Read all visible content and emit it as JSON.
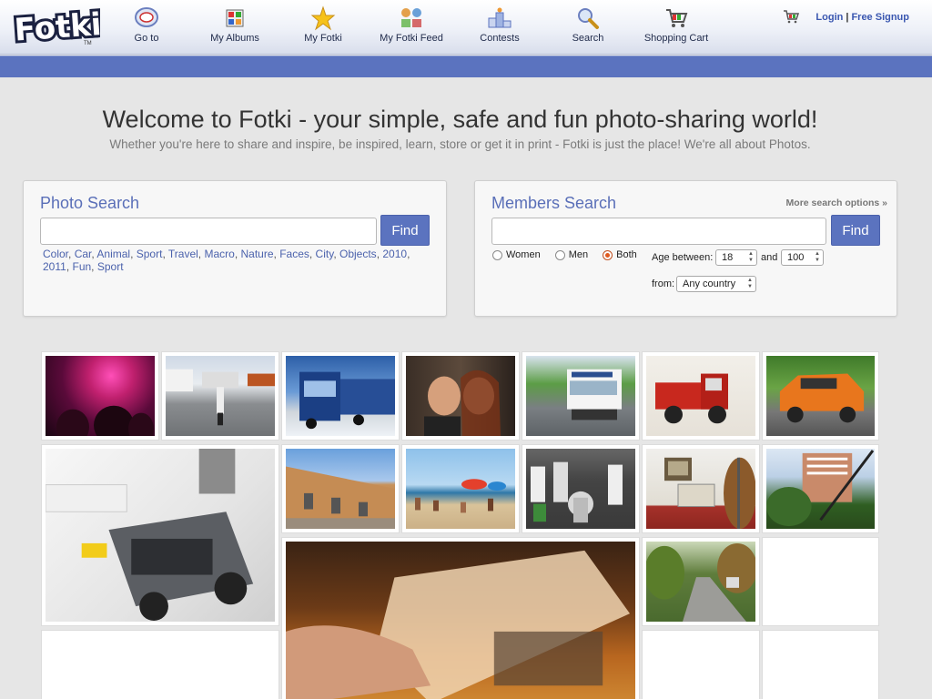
{
  "header": {
    "logo_text": "Fotki",
    "nav": [
      {
        "label": "Go to",
        "icon": "compass-icon"
      },
      {
        "label": "My Albums",
        "icon": "albums-icon"
      },
      {
        "label": "My Fotki",
        "icon": "star-icon"
      },
      {
        "label": "My Fotki Feed",
        "icon": "feed-icon"
      },
      {
        "label": "Contests",
        "icon": "podium-icon"
      },
      {
        "label": "Search",
        "icon": "magnifier-icon"
      },
      {
        "label": "Shopping Cart",
        "icon": "cart-icon"
      }
    ],
    "login": "Login",
    "separator": "|",
    "signup": "Free Signup"
  },
  "welcome": {
    "title": "Welcome to Fotki - your simple, safe and fun photo-sharing world!",
    "tagline": "Whether you're here to share and inspire, be inspired, learn, store or get it in print - Fotki is just the place! We're all about Photos."
  },
  "photo_search": {
    "title": "Photo Search",
    "input_value": "",
    "find_label": "Find",
    "tags": [
      "Color",
      "Car",
      "Animal",
      "Sport",
      "Travel",
      "Macro",
      "Nature",
      "Faces",
      "City",
      "Objects",
      "2010",
      "2011",
      "Fun",
      "Sport"
    ]
  },
  "members_search": {
    "title": "Members Search",
    "more_options": "More search options »",
    "input_value": "",
    "find_label": "Find",
    "gender": {
      "women": "Women",
      "men": "Men",
      "both": "Both",
      "selected": "Both"
    },
    "age_label": "Age between:",
    "age_min": "18",
    "and_label": "and",
    "age_max": "100",
    "from_label": "from:",
    "country": "Any country"
  },
  "colors": {
    "brand_blue": "#5b73bf",
    "link_blue": "#4b62ac",
    "radio_selected": "#e05a1e"
  }
}
